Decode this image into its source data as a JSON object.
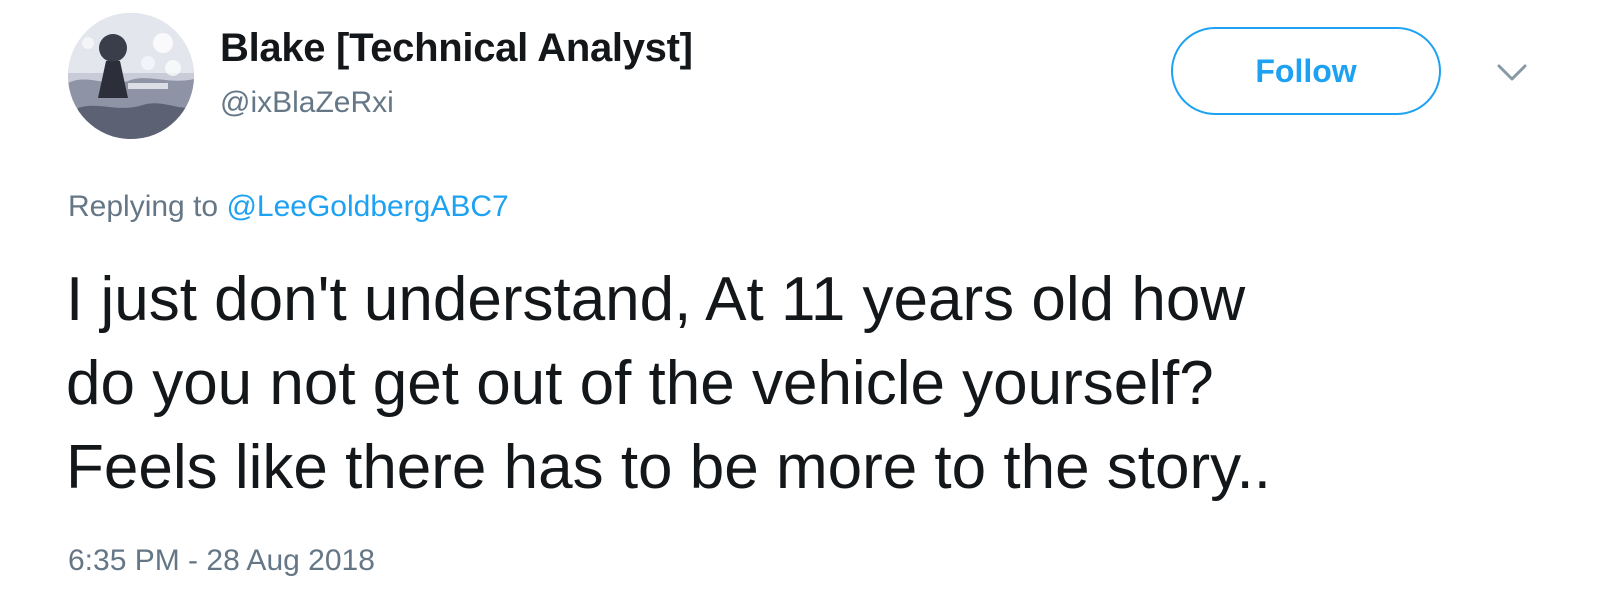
{
  "author": {
    "display_name": "Blake [Technical Analyst]",
    "handle": "@ixBlaZeRxi",
    "avatar_icon": "profile-photo-avatar"
  },
  "actions": {
    "follow_label": "Follow",
    "menu_icon": "chevron-down-icon"
  },
  "reply": {
    "prefix": "Replying to",
    "mention": "@LeeGoldbergABC7"
  },
  "tweet": {
    "lines": [
      "I just don't understand, At 11 years old how",
      "do you not get out of the vehicle yourself?",
      "Feels like there has to be more to the story.."
    ],
    "timestamp": "6:35 PM - 28 Aug 2018"
  },
  "colors": {
    "accent": "#1da1f2",
    "text_primary": "#14171a",
    "text_secondary": "#657786"
  }
}
